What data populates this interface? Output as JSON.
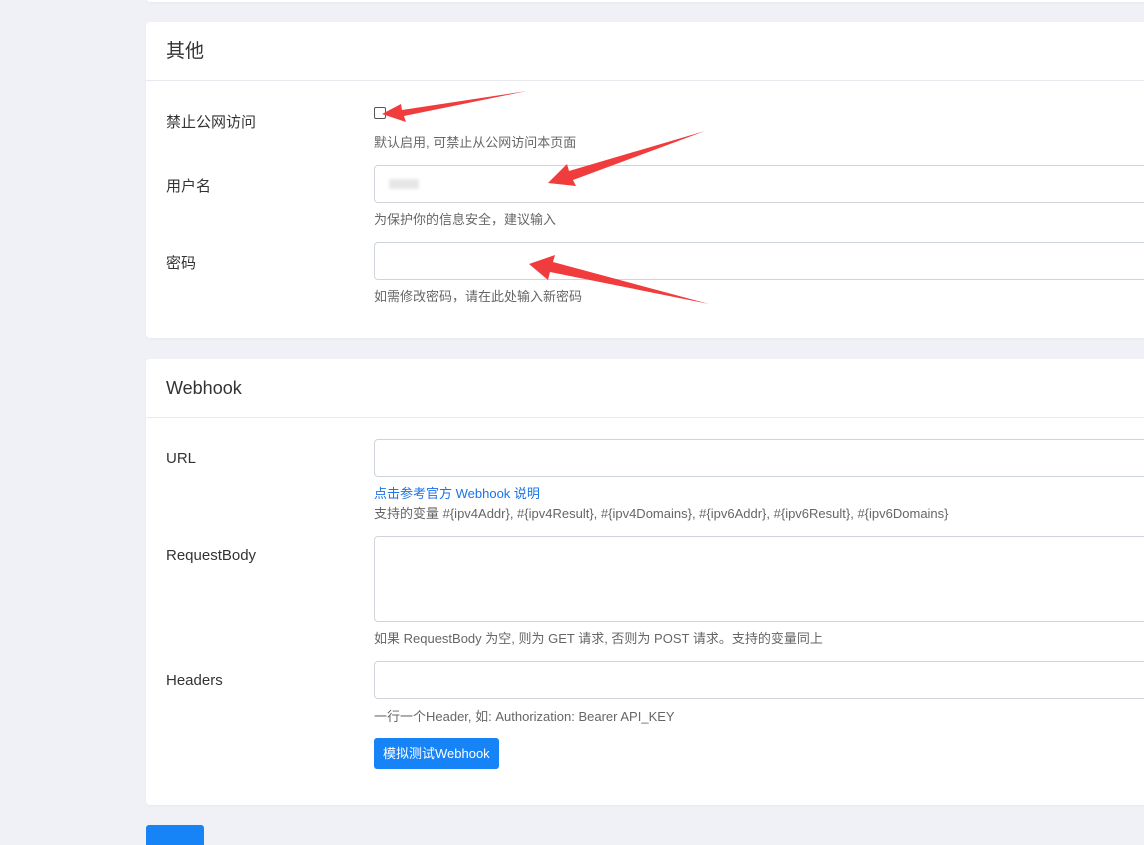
{
  "other": {
    "title": "其他",
    "disable_public": {
      "label": "禁止公网访问",
      "help": "默认启用, 可禁止从公网访问本页面",
      "checked": false
    },
    "username": {
      "label": "用户名",
      "help": "为保护你的信息安全，建议输入",
      "value_masked": true
    },
    "password": {
      "label": "密码",
      "help": "如需修改密码，请在此处输入新密码",
      "value": ""
    }
  },
  "webhook": {
    "title": "Webhook",
    "url": {
      "label": "URL",
      "value": "",
      "link": "点击参考官方 Webhook 说明",
      "help": "支持的变量 #{ipv4Addr}, #{ipv4Result}, #{ipv4Domains}, #{ipv6Addr}, #{ipv6Result}, #{ipv6Domains}"
    },
    "request_body": {
      "label": "RequestBody",
      "value": "",
      "help": "如果 RequestBody 为空, 则为 GET 请求, 否则为 POST 请求。支持的变量同上"
    },
    "headers": {
      "label": "Headers",
      "value": "",
      "help": "一行一个Header, 如: Authorization: Bearer API_KEY"
    },
    "test_button": "模拟测试Webhook"
  },
  "colors": {
    "primary": "#1683f6",
    "link": "#1a73e8",
    "annotation_arrow": "#f03c3c",
    "page_background": "#f0f1f6"
  },
  "icons": {
    "checkbox": "checkbox-unchecked",
    "annotation": "red-arrow"
  }
}
